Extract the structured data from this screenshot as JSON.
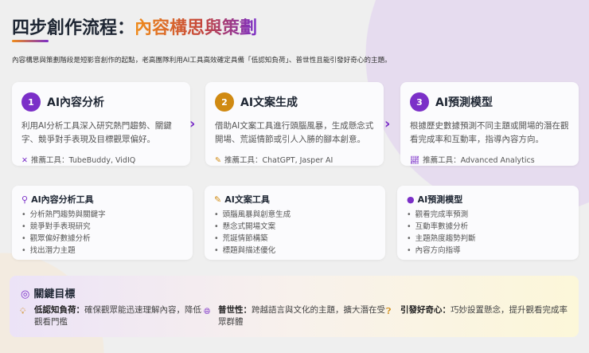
{
  "header": {
    "title_main": "四步創作流程：",
    "title_highlight": "內容構思與策劃",
    "subtitle": "內容構思與策劃階段是短影音創作的起點，老高團隊利用AI工具高效確定具備「低認知負荷」、普世性且能引發好奇心的主題。"
  },
  "steps": [
    {
      "number": "1",
      "title": "AI內容分析",
      "desc": "利用AI分析工具深入研究熱門趨勢、關鍵字、競爭對手表現及目標觀眾偏好。",
      "tool": "推薦工具：TubeBuddy, VidIQ",
      "color": "#7b2fc8",
      "icon": "tools-icon"
    },
    {
      "number": "2",
      "title": "AI文案生成",
      "desc": "借助AI文案工具進行頭腦風暴，生成懸念式開場、荒誕情節或引人入勝的腳本創意。",
      "tool": "推薦工具：ChatGPT, Jasper AI",
      "color": "#d08a12",
      "icon": "brush-icon"
    },
    {
      "number": "3",
      "title": "AI預測模型",
      "desc": "根據歷史數據預測不同主題或開場的潛在觀看完成率和互動率，指導內容方向。",
      "tool": "推薦工具：Advanced Analytics",
      "color": "#7b2fc8",
      "icon": "chart-icon"
    }
  ],
  "tools": [
    {
      "title": "AI內容分析工具",
      "icon": "search-icon",
      "items": [
        "分析熱門趨勢與關鍵字",
        "競爭對手表現研究",
        "觀眾偏好數據分析",
        "找出潛力主題"
      ]
    },
    {
      "title": "AI文案工具",
      "icon": "pencil-icon",
      "items": [
        "頭腦風暴與創意生成",
        "懸念式開場文案",
        "荒誕情節構築",
        "標題與描述優化"
      ]
    },
    {
      "title": "AI預測模型",
      "icon": "brain-icon",
      "items": [
        "觀看完成率預測",
        "互動率數據分析",
        "主題熱度趨勢判斷",
        "內容方向指導"
      ]
    }
  ],
  "goals": {
    "title": "關鍵目標",
    "items": [
      {
        "label": "低認知負荷：",
        "text": "確保觀眾能迅速理解內容，降低觀看門檻"
      },
      {
        "label": "普世性：",
        "text": "跨越語言與文化的主題，擴大潛在受眾群體"
      },
      {
        "label": "引發好奇心：",
        "text": "巧妙設置懸念，提升觀看完成率"
      }
    ]
  }
}
